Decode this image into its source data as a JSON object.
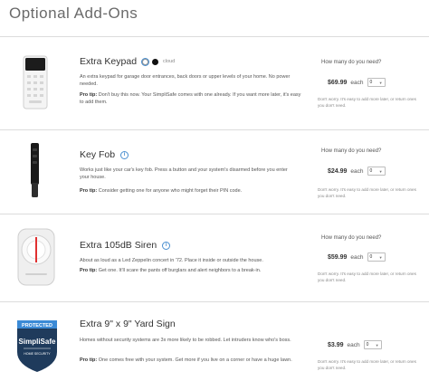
{
  "page": {
    "title": "Optional Add-Ons"
  },
  "products": [
    {
      "name": "Extra Keypad",
      "color_label": "cloud",
      "description": "An extra keypad for garage door entrances, back doors or upper levels of your home. No power needed.",
      "tip_label": "Pro tip:",
      "tip": "Don't buy this now. Your SimpliSafe comes with one already. If you want more later, it's easy to add them.",
      "question": "How many do you need?",
      "price": "$69.99",
      "each": "each",
      "qty": "0",
      "note": "Don't worry. It's easy to add more later, or return ones you don't need."
    },
    {
      "name": "Key Fob",
      "description": "Works just like your car's key fob. Press a button and your system's disarmed before you enter your house.",
      "tip_label": "Pro tip:",
      "tip": "Consider getting one for anyone who might forget their PIN code.",
      "question": "How many do you need?",
      "price": "$24.99",
      "each": "each",
      "qty": "0",
      "note": "Don't worry. It's easy to add more later, or return ones you don't need."
    },
    {
      "name": "Extra 105dB Siren",
      "description": "About as loud as a Led Zeppelin concert in '72. Place it inside or outside the house.",
      "tip_label": "Pro tip:",
      "tip": "Get one. It'll scare the pants off burglars and alert neighbors to a break-in.",
      "question": "How many do you need?",
      "price": "$59.99",
      "each": "each",
      "qty": "0",
      "note": "Don't worry. It's easy to add more later, or return ones you don't need."
    },
    {
      "name": "Extra 9\" x 9\" Yard Sign",
      "description": "Homes without security systems are 3x more likely to be robbed. Let intruders know who's boss.",
      "tip_label": "Pro tip:",
      "tip": "One comes free with your system. Get more if you live on a corner or have a huge lawn.",
      "question": "",
      "price": "$3.99",
      "each": "each",
      "qty": "0",
      "note": "Don't worry. It's easy to add more later, or return ones you don't need."
    }
  ],
  "sign": {
    "top": "PROTECTED",
    "brand": "SimpliSafe",
    "bottom": "HOME SECURITY"
  },
  "colors": {
    "accent": "#4a8fd0",
    "sign_navy": "#1f3b5c",
    "sign_blue": "#3b8ad6"
  },
  "icons": [
    "info-icon",
    "keypad-image",
    "key-fob-image",
    "siren-image",
    "yard-sign-image",
    "chevron-down-icon"
  ]
}
